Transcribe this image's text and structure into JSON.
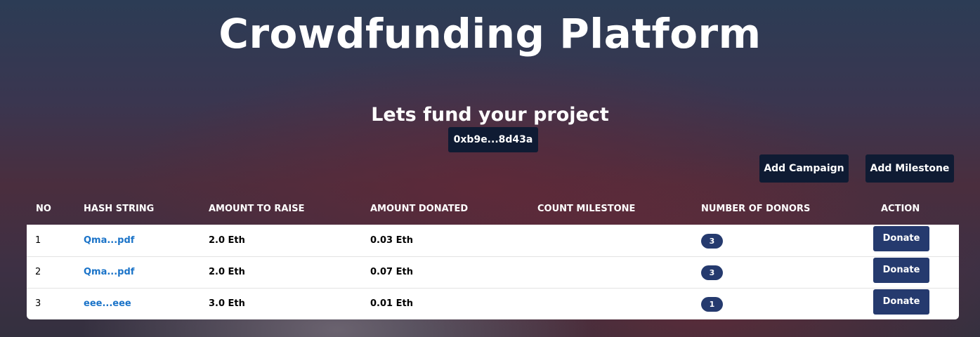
{
  "header": {
    "title": "Crowdfunding Platform",
    "subtitle": "Lets fund your project",
    "address": "0xb9e...8d43a"
  },
  "actions": {
    "add_campaign": "Add Campaign",
    "add_milestone": "Add Milestone"
  },
  "table": {
    "columns": [
      "NO",
      "HASH STRING",
      "AMOUNT TO RAISE",
      "AMOUNT DONATED",
      "COUNT MILESTONE",
      "NUMBER OF DONORS",
      "ACTION"
    ],
    "rows": [
      {
        "no": "1",
        "hash": "Qma...pdf",
        "raise": "2.0 Eth",
        "donated": "0.03 Eth",
        "milestones": "",
        "donors": "3",
        "action": "Donate"
      },
      {
        "no": "2",
        "hash": "Qma...pdf",
        "raise": "2.0 Eth",
        "donated": "0.07 Eth",
        "milestones": "",
        "donors": "3",
        "action": "Donate"
      },
      {
        "no": "3",
        "hash": "eee...eee",
        "raise": "3.0 Eth",
        "donated": "0.01 Eth",
        "milestones": "",
        "donors": "1",
        "action": "Donate"
      }
    ]
  },
  "colors": {
    "dark_button": "#0f1b33",
    "donate_button": "#253a6e",
    "link": "#1a73c8"
  }
}
